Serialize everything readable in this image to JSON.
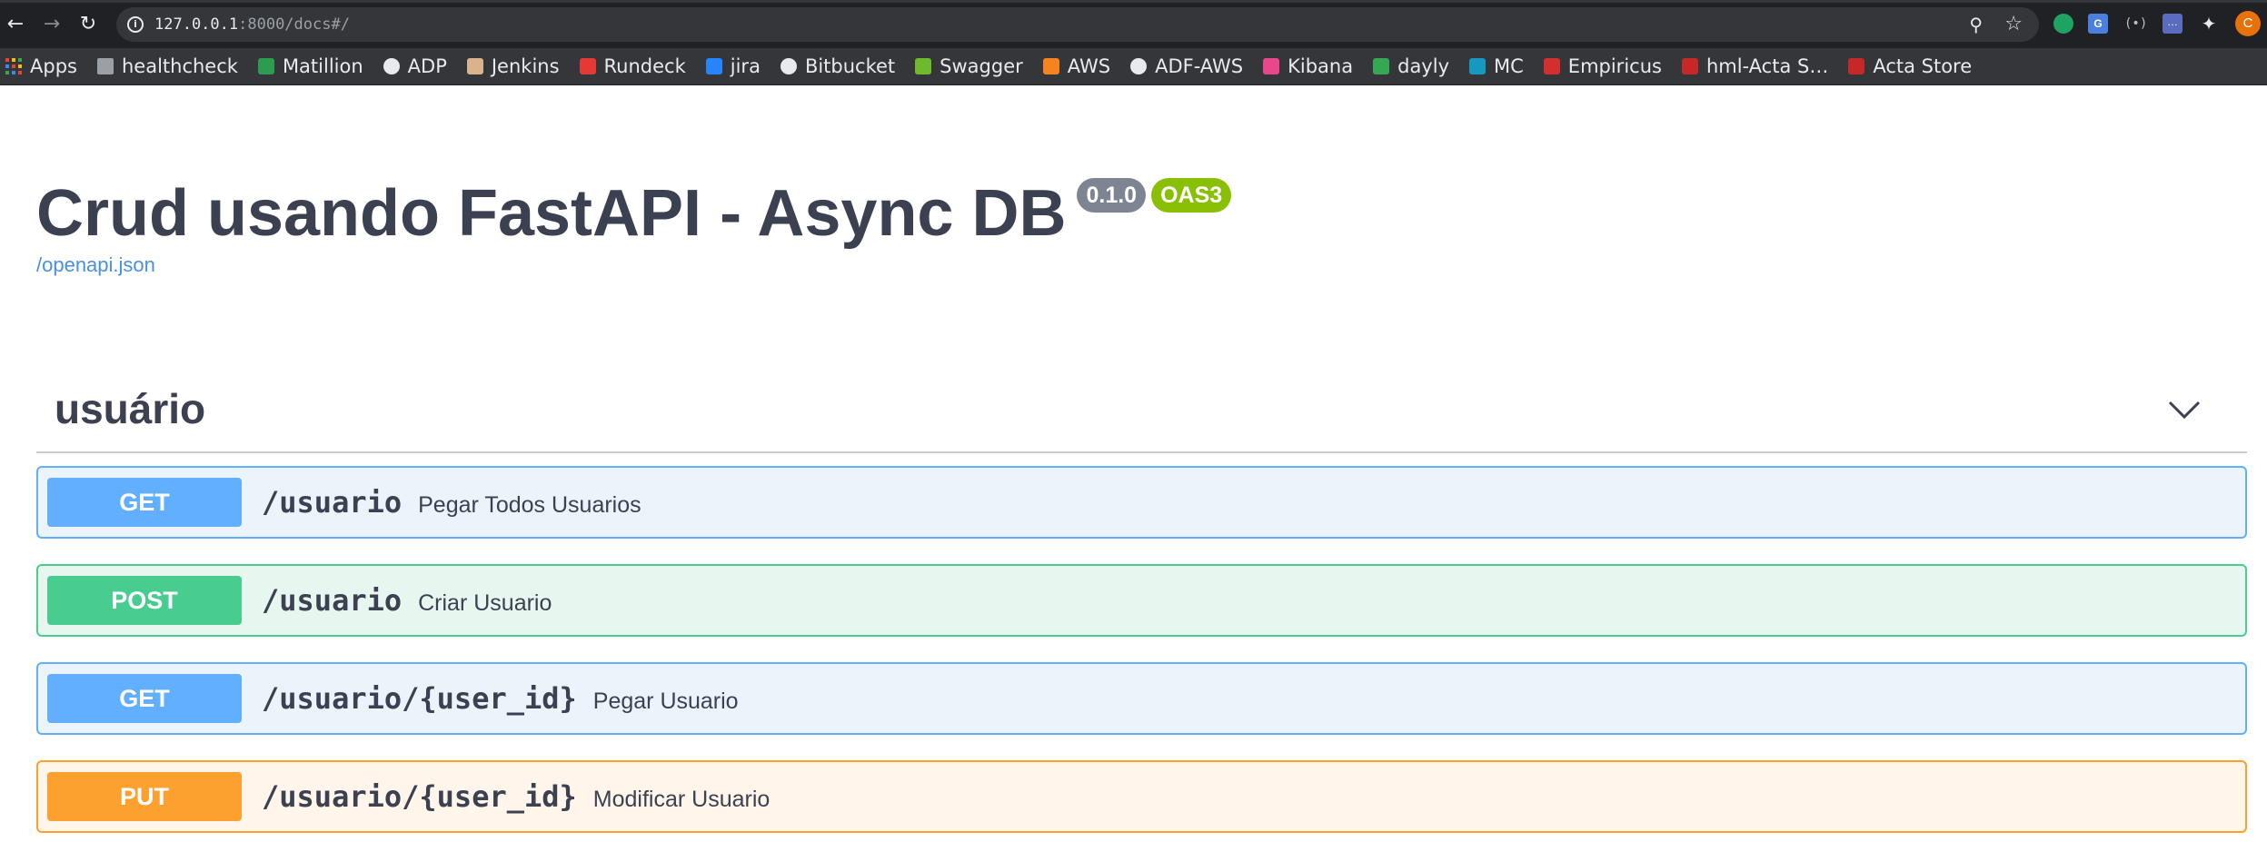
{
  "browser": {
    "url_host": "127.0.0.1",
    "url_rest": ":8000/docs#/",
    "profile_initial": "C",
    "bookmarks": [
      {
        "label": "Apps",
        "icon": "apps-grid-icon",
        "color": "#ea4335"
      },
      {
        "label": "healthcheck",
        "icon": "folder-icon",
        "color": "#9aa0a6"
      },
      {
        "label": "Matillion",
        "icon": "matillion-icon",
        "color": "#2d9c4e"
      },
      {
        "label": "ADP",
        "icon": "globe-icon",
        "color": "#e8eaed"
      },
      {
        "label": "Jenkins",
        "icon": "jenkins-icon",
        "color": "#d9b38c"
      },
      {
        "label": "Rundeck",
        "icon": "rundeck-icon",
        "color": "#e53935"
      },
      {
        "label": "jira",
        "icon": "jira-icon",
        "color": "#2684ff"
      },
      {
        "label": "Bitbucket",
        "icon": "globe-icon",
        "color": "#e8eaed"
      },
      {
        "label": "Swagger",
        "icon": "swagger-icon",
        "color": "#6fba2c"
      },
      {
        "label": "AWS",
        "icon": "aws-icon",
        "color": "#f5831f"
      },
      {
        "label": "ADF-AWS",
        "icon": "globe-icon",
        "color": "#e8eaed"
      },
      {
        "label": "Kibana",
        "icon": "kibana-icon",
        "color": "#e8478b"
      },
      {
        "label": "dayly",
        "icon": "meet-icon",
        "color": "#34a853"
      },
      {
        "label": "MC",
        "icon": "salesforce-icon",
        "color": "#1798c1"
      },
      {
        "label": "Empiricus",
        "icon": "empiricus-icon",
        "color": "#d32f2f"
      },
      {
        "label": "hml-Acta S…",
        "icon": "acta-icon",
        "color": "#c62828"
      },
      {
        "label": "Acta Store",
        "icon": "acta-icon",
        "color": "#c62828"
      }
    ]
  },
  "info": {
    "title": "Crud usando FastAPI - Async DB",
    "version": "0.1.0",
    "oas": "OAS3",
    "spec_link": "/openapi.json"
  },
  "tag": {
    "name": "usuário"
  },
  "operations": [
    {
      "method": "GET",
      "path": "/usuario",
      "summary": "Pegar Todos Usuarios",
      "color": "#61affe"
    },
    {
      "method": "POST",
      "path": "/usuario",
      "summary": "Criar Usuario",
      "color": "#49cc90"
    },
    {
      "method": "GET",
      "path": "/usuario/{user_id}",
      "summary": "Pegar Usuario",
      "color": "#61affe"
    },
    {
      "method": "PUT",
      "path": "/usuario/{user_id}",
      "summary": "Modificar Usuario",
      "color": "#fca130"
    }
  ]
}
